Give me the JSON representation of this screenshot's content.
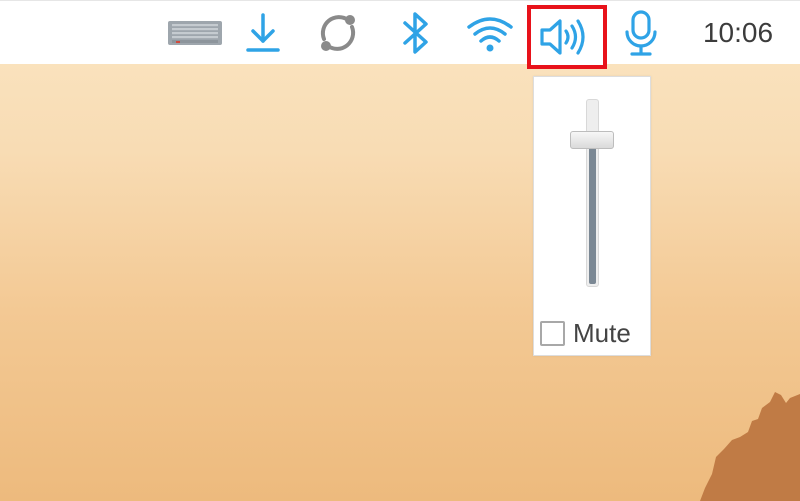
{
  "taskbar": {
    "tray_icons": [
      {
        "name": "keyboard-icon"
      },
      {
        "name": "download-icon"
      },
      {
        "name": "sync-icon"
      },
      {
        "name": "bluetooth-icon"
      },
      {
        "name": "wifi-icon"
      },
      {
        "name": "volume-icon",
        "highlighted": true,
        "highlight_color": "#e8121a"
      },
      {
        "name": "microphone-icon"
      }
    ],
    "clock_text": "10:06",
    "icon_color": "#2fa3e6"
  },
  "volume_popup": {
    "volume_level": 0.81,
    "mute_label": "Mute",
    "mute_checked": false
  }
}
